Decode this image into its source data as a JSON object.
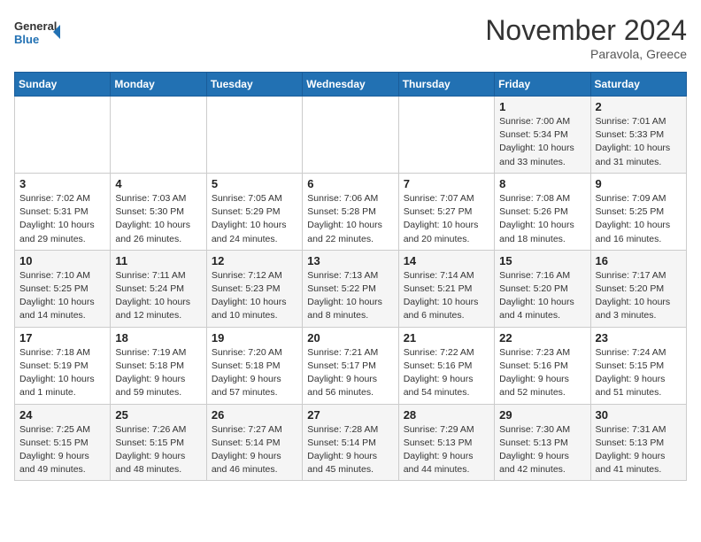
{
  "logo": {
    "line1": "General",
    "line2": "Blue"
  },
  "header": {
    "month": "November 2024",
    "location": "Paravola, Greece"
  },
  "weekdays": [
    "Sunday",
    "Monday",
    "Tuesday",
    "Wednesday",
    "Thursday",
    "Friday",
    "Saturday"
  ],
  "weeks": [
    [
      {
        "day": "",
        "info": ""
      },
      {
        "day": "",
        "info": ""
      },
      {
        "day": "",
        "info": ""
      },
      {
        "day": "",
        "info": ""
      },
      {
        "day": "",
        "info": ""
      },
      {
        "day": "1",
        "info": "Sunrise: 7:00 AM\nSunset: 5:34 PM\nDaylight: 10 hours\nand 33 minutes."
      },
      {
        "day": "2",
        "info": "Sunrise: 7:01 AM\nSunset: 5:33 PM\nDaylight: 10 hours\nand 31 minutes."
      }
    ],
    [
      {
        "day": "3",
        "info": "Sunrise: 7:02 AM\nSunset: 5:31 PM\nDaylight: 10 hours\nand 29 minutes."
      },
      {
        "day": "4",
        "info": "Sunrise: 7:03 AM\nSunset: 5:30 PM\nDaylight: 10 hours\nand 26 minutes."
      },
      {
        "day": "5",
        "info": "Sunrise: 7:05 AM\nSunset: 5:29 PM\nDaylight: 10 hours\nand 24 minutes."
      },
      {
        "day": "6",
        "info": "Sunrise: 7:06 AM\nSunset: 5:28 PM\nDaylight: 10 hours\nand 22 minutes."
      },
      {
        "day": "7",
        "info": "Sunrise: 7:07 AM\nSunset: 5:27 PM\nDaylight: 10 hours\nand 20 minutes."
      },
      {
        "day": "8",
        "info": "Sunrise: 7:08 AM\nSunset: 5:26 PM\nDaylight: 10 hours\nand 18 minutes."
      },
      {
        "day": "9",
        "info": "Sunrise: 7:09 AM\nSunset: 5:25 PM\nDaylight: 10 hours\nand 16 minutes."
      }
    ],
    [
      {
        "day": "10",
        "info": "Sunrise: 7:10 AM\nSunset: 5:25 PM\nDaylight: 10 hours\nand 14 minutes."
      },
      {
        "day": "11",
        "info": "Sunrise: 7:11 AM\nSunset: 5:24 PM\nDaylight: 10 hours\nand 12 minutes."
      },
      {
        "day": "12",
        "info": "Sunrise: 7:12 AM\nSunset: 5:23 PM\nDaylight: 10 hours\nand 10 minutes."
      },
      {
        "day": "13",
        "info": "Sunrise: 7:13 AM\nSunset: 5:22 PM\nDaylight: 10 hours\nand 8 minutes."
      },
      {
        "day": "14",
        "info": "Sunrise: 7:14 AM\nSunset: 5:21 PM\nDaylight: 10 hours\nand 6 minutes."
      },
      {
        "day": "15",
        "info": "Sunrise: 7:16 AM\nSunset: 5:20 PM\nDaylight: 10 hours\nand 4 minutes."
      },
      {
        "day": "16",
        "info": "Sunrise: 7:17 AM\nSunset: 5:20 PM\nDaylight: 10 hours\nand 3 minutes."
      }
    ],
    [
      {
        "day": "17",
        "info": "Sunrise: 7:18 AM\nSunset: 5:19 PM\nDaylight: 10 hours\nand 1 minute."
      },
      {
        "day": "18",
        "info": "Sunrise: 7:19 AM\nSunset: 5:18 PM\nDaylight: 9 hours\nand 59 minutes."
      },
      {
        "day": "19",
        "info": "Sunrise: 7:20 AM\nSunset: 5:18 PM\nDaylight: 9 hours\nand 57 minutes."
      },
      {
        "day": "20",
        "info": "Sunrise: 7:21 AM\nSunset: 5:17 PM\nDaylight: 9 hours\nand 56 minutes."
      },
      {
        "day": "21",
        "info": "Sunrise: 7:22 AM\nSunset: 5:16 PM\nDaylight: 9 hours\nand 54 minutes."
      },
      {
        "day": "22",
        "info": "Sunrise: 7:23 AM\nSunset: 5:16 PM\nDaylight: 9 hours\nand 52 minutes."
      },
      {
        "day": "23",
        "info": "Sunrise: 7:24 AM\nSunset: 5:15 PM\nDaylight: 9 hours\nand 51 minutes."
      }
    ],
    [
      {
        "day": "24",
        "info": "Sunrise: 7:25 AM\nSunset: 5:15 PM\nDaylight: 9 hours\nand 49 minutes."
      },
      {
        "day": "25",
        "info": "Sunrise: 7:26 AM\nSunset: 5:15 PM\nDaylight: 9 hours\nand 48 minutes."
      },
      {
        "day": "26",
        "info": "Sunrise: 7:27 AM\nSunset: 5:14 PM\nDaylight: 9 hours\nand 46 minutes."
      },
      {
        "day": "27",
        "info": "Sunrise: 7:28 AM\nSunset: 5:14 PM\nDaylight: 9 hours\nand 45 minutes."
      },
      {
        "day": "28",
        "info": "Sunrise: 7:29 AM\nSunset: 5:13 PM\nDaylight: 9 hours\nand 44 minutes."
      },
      {
        "day": "29",
        "info": "Sunrise: 7:30 AM\nSunset: 5:13 PM\nDaylight: 9 hours\nand 42 minutes."
      },
      {
        "day": "30",
        "info": "Sunrise: 7:31 AM\nSunset: 5:13 PM\nDaylight: 9 hours\nand 41 minutes."
      }
    ]
  ]
}
